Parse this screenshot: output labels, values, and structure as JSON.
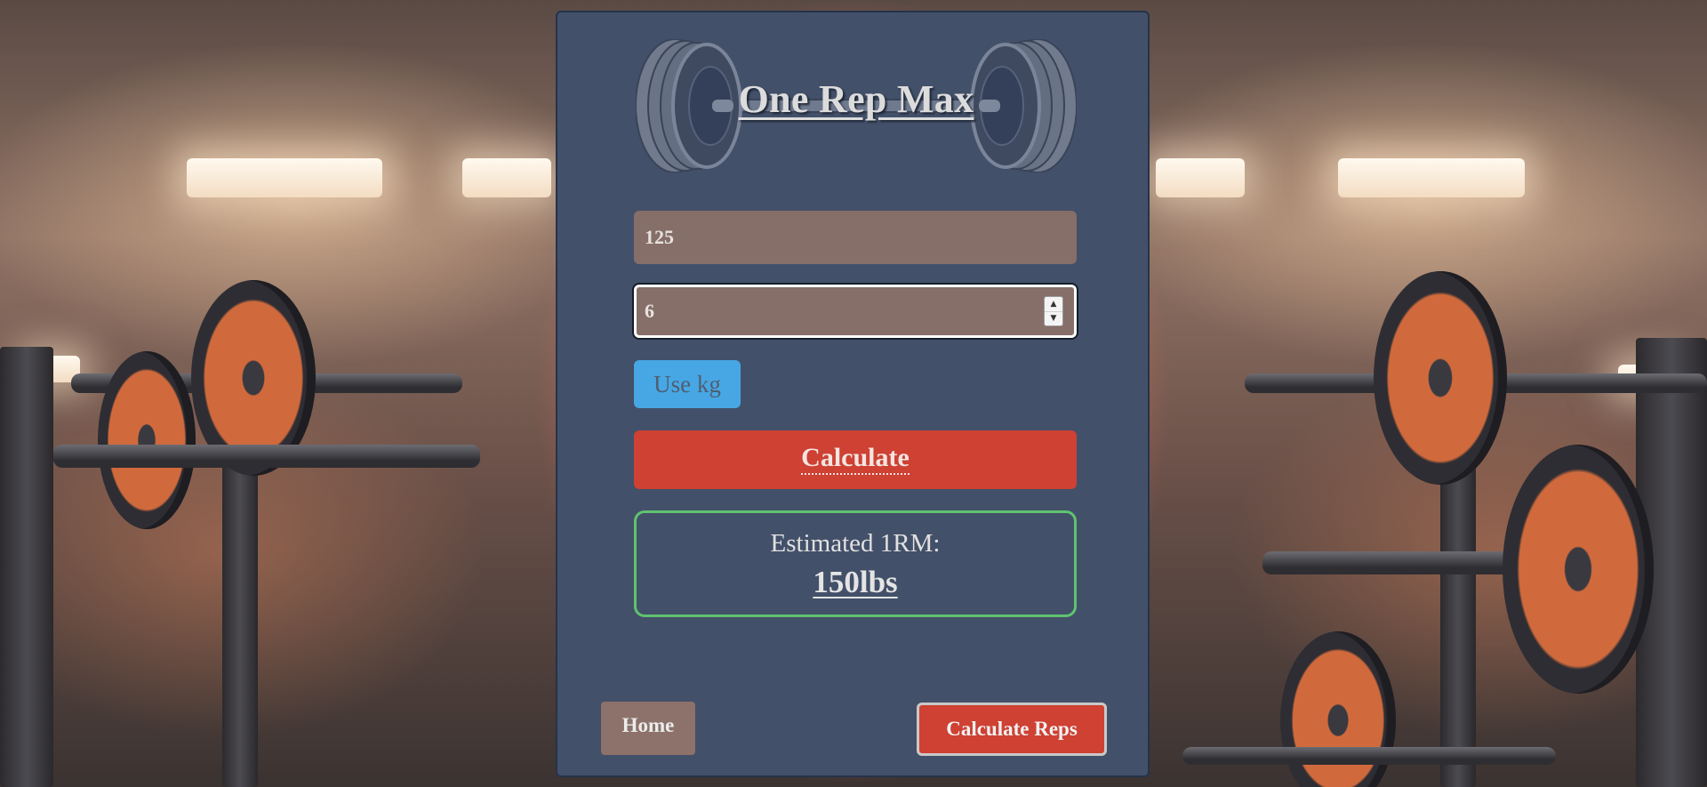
{
  "app": {
    "title": "One Rep Max"
  },
  "form": {
    "weight_value": "125",
    "reps_value": "6",
    "unit_toggle_label": "Use kg",
    "calculate_label": "Calculate"
  },
  "result": {
    "label": "Estimated 1RM:",
    "value": "150lbs"
  },
  "footer": {
    "home_label": "Home",
    "calculate_reps_label": "Calculate Reps"
  },
  "icons": {
    "header": "barbell-icon",
    "spinner_up": "caret-up-icon",
    "spinner_down": "caret-down-icon"
  },
  "colors": {
    "card_bg": "#435069",
    "input_bg": "#866f68",
    "unit_button": "#47a7e4",
    "calculate_button": "#ce4133",
    "result_border": "#5fc36f",
    "home_button": "#8c726b"
  }
}
